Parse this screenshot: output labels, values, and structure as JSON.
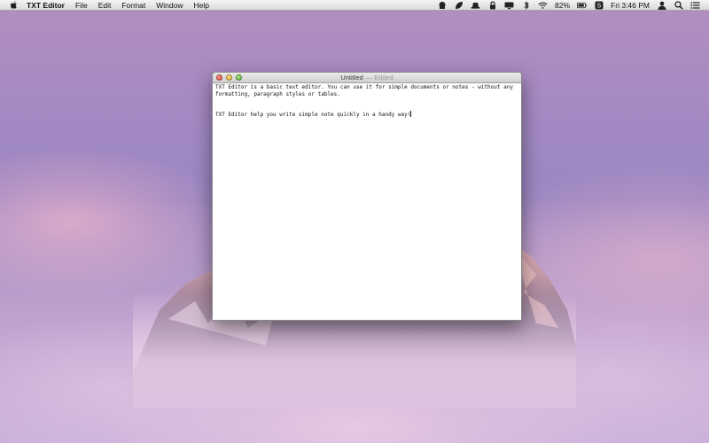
{
  "menubar": {
    "app_name": "TXT Editor",
    "items": [
      "File",
      "Edit",
      "Format",
      "Window",
      "Help"
    ],
    "status": {
      "battery": "82%",
      "clock": "Fri 3:46 PM"
    }
  },
  "window": {
    "title": "Untitled",
    "edited": "— Edited",
    "paragraphs": [
      "TXT Editor is a basic text editor. You can use it for simple documents or notes - without any formatting, paragraph styles or tables.",
      "TXT Editor help you write simple note quickly in a handy way!"
    ]
  }
}
